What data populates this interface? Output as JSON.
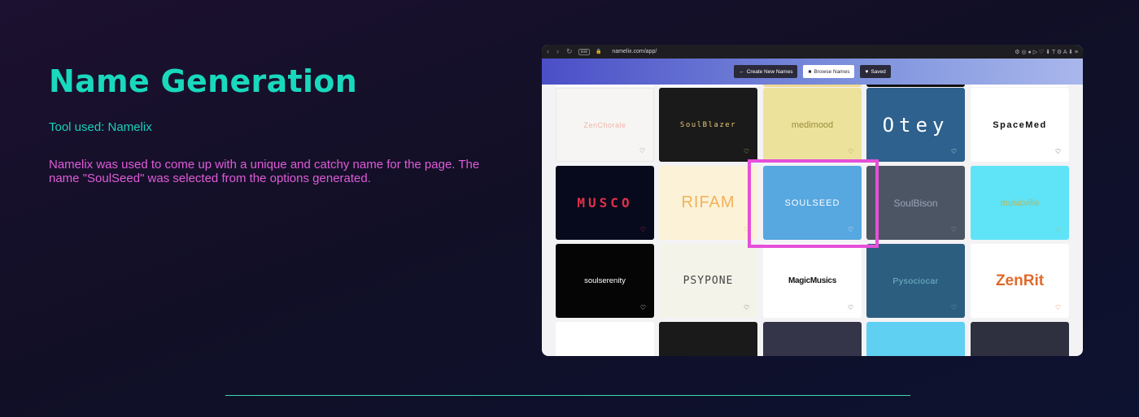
{
  "slide": {
    "title": "Name Generation",
    "tool_used": "Tool used: Namelix",
    "description": "Namelix was used to come up with a unique and catchy name for the page. The name \"SoulSeed\" was selected from the options generated."
  },
  "browser": {
    "url": "namelix.com/app/",
    "nav_back": "‹",
    "nav_forward": "›",
    "reload": "↻",
    "tracking_tag": "⊞⊞",
    "lock": "🔒",
    "toolbar_icons": "⚙ ◎ ● ▷ ♡ ⬇ T ⚙ A ⬇ ≡"
  },
  "app": {
    "create_label": "Create New Names",
    "create_icon": "←",
    "browse_label": "Browse Names",
    "browse_icon": "■",
    "saved_label": "Saved",
    "saved_icon": "♥"
  },
  "cards": [
    {
      "name": "ZenChorale",
      "bg": "#f6f5f3",
      "color": "#f2b4ad",
      "heart": "#777777"
    },
    {
      "name": "SoulBlazer",
      "bg": "#1a1a1a",
      "color": "#e7c67a",
      "heart": "#e7c67a"
    },
    {
      "name": "medimood",
      "bg": "#ede29c",
      "color": "#9b8c3a",
      "heart": "#9b8c3a"
    },
    {
      "name": "Otey",
      "bg": "#2e618d",
      "color": "#ffffff",
      "heart": "#ffffff"
    },
    {
      "name": "SpaceMed",
      "bg": "#ffffff",
      "color": "#111111",
      "heart": "#111111"
    },
    {
      "name": "MUSCO",
      "bg": "#070a1c",
      "color": "#e0304a",
      "heart": "#e0304a"
    },
    {
      "name": "RIFAM",
      "bg": "#fbf2d7",
      "color": "#f2b25a",
      "heart": "#f2b25a"
    },
    {
      "name": "SOULSEED",
      "bg": "#57a7e0",
      "color": "#ffffff",
      "heart": "#ffffff"
    },
    {
      "name": "SoulBison",
      "bg": "#4c5563",
      "color": "#9aa4b6",
      "heart": "#9aa4b6"
    },
    {
      "name": "musicville",
      "bg": "#5fe3f7",
      "color": "#b5b75e",
      "heart": "#b5b75e"
    },
    {
      "name": "soulserenity",
      "bg": "#050505",
      "color": "#ffffff",
      "heart": "#ffffff"
    },
    {
      "name": "PSYPONE",
      "bg": "#f4f3e9",
      "color": "#444444",
      "heart": "#444444"
    },
    {
      "name": "MagicMusics",
      "bg": "#ffffff",
      "color": "#111111",
      "heart": "#333333"
    },
    {
      "name": "Pysociocar",
      "bg": "#2c5e80",
      "color": "#74b9c9",
      "heart": "#74b9c9"
    },
    {
      "name": "ZenRit",
      "bg": "#ffffff",
      "color": "#e06a2c",
      "heart": "#e06a2c"
    },
    {
      "name": "",
      "bg": "#ffffff",
      "color": "#333333",
      "heart": ""
    },
    {
      "name": "",
      "bg": "#1a1a1a",
      "color": "#ffffff",
      "heart": ""
    },
    {
      "name": "",
      "bg": "#35354a",
      "color": "#ffffff",
      "heart": ""
    },
    {
      "name": "",
      "bg": "#5fd0f2",
      "color": "#ffffff",
      "heart": ""
    },
    {
      "name": "",
      "bg": "#2e3040",
      "color": "#ffffff",
      "heart": ""
    }
  ],
  "heart_glyph": "♡"
}
